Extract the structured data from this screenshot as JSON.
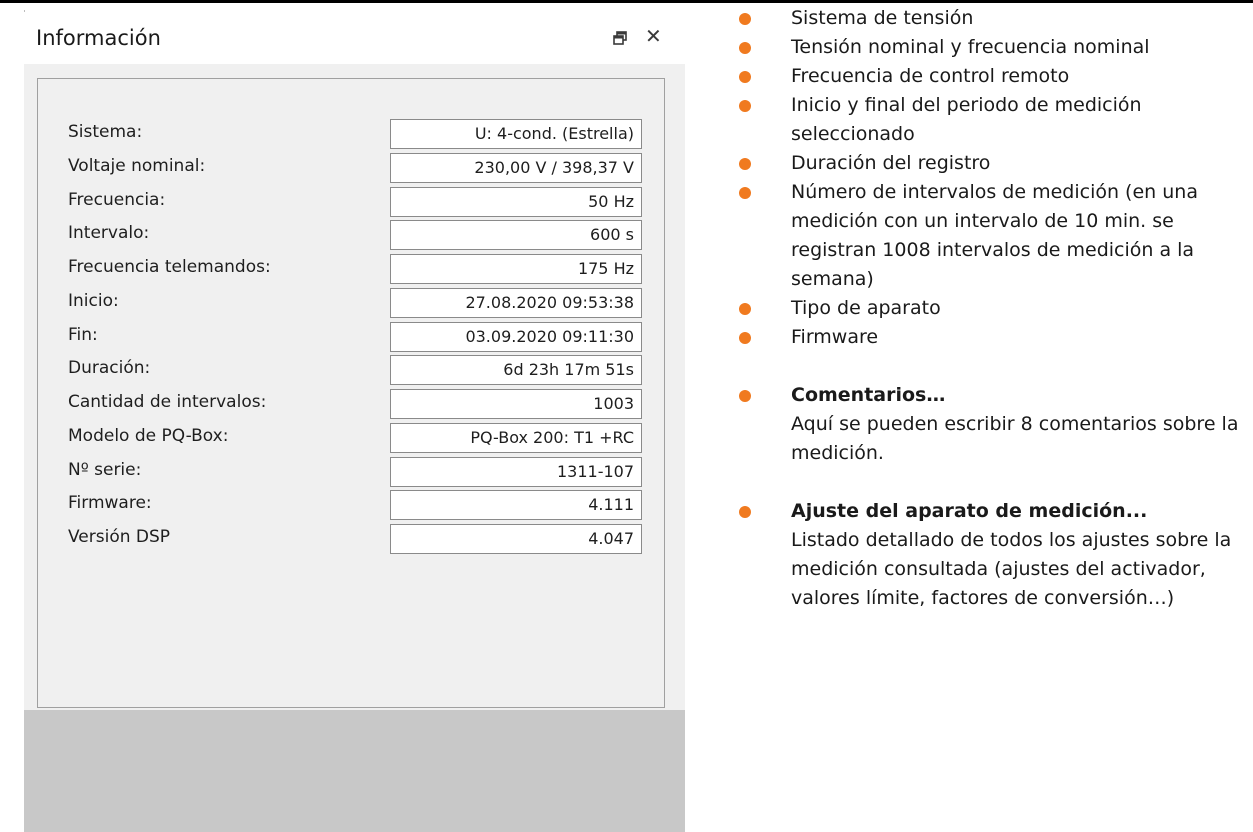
{
  "window": {
    "title": "Información"
  },
  "info_rows": [
    {
      "label": "Sistema:",
      "value": "U: 4-cond. (Estrella)"
    },
    {
      "label": "Voltaje nominal:",
      "value": "230,00 V / 398,37 V"
    },
    {
      "label": "Frecuencia:",
      "value": "50 Hz"
    },
    {
      "label": "Intervalo:",
      "value": "600 s"
    },
    {
      "label": "Frecuencia telemandos:",
      "value": "175 Hz"
    },
    {
      "label": "Inicio:",
      "value": "27.08.2020 09:53:38"
    },
    {
      "label": "Fin:",
      "value": "03.09.2020 09:11:30"
    },
    {
      "label": "Duración:",
      "value": "6d 23h 17m 51s"
    },
    {
      "label": "Cantidad de intervalos:",
      "value": "1003"
    },
    {
      "label": "Modelo de PQ-Box:",
      "value": "PQ-Box 200: T1 +RC"
    },
    {
      "label": "Nº serie:",
      "value": "1311-107"
    },
    {
      "label": "Firmware:",
      "value": "4.111"
    },
    {
      "label": "Versión DSP",
      "value": "4.047"
    }
  ],
  "bullets": [
    "Sistema de tensión",
    "Tensión nominal y frecuencia nominal",
    "Frecuencia de control remoto",
    "Inicio y final del periodo de medición seleccionado",
    "Duración del registro",
    "Número de intervalos de medición (en una medición con un intervalo de 10 min. se registran 1008 intervalos de medición a la semana)",
    "Tipo de aparato",
    "Firmware"
  ],
  "notes": [
    {
      "title": "Comentarios…",
      "text": "Aquí se pueden escribir 8 comentarios sobre la medición."
    },
    {
      "title": "Ajuste del aparato de medición...",
      "text": "Listado detallado de todos los ajustes sobre la medición consultada (ajustes del activador, valores límite, factores de conversión…)"
    }
  ],
  "colors": {
    "bullet": "#f07a1f"
  },
  "icons": {
    "restore": "restore-window-icon",
    "close": "close-icon"
  }
}
